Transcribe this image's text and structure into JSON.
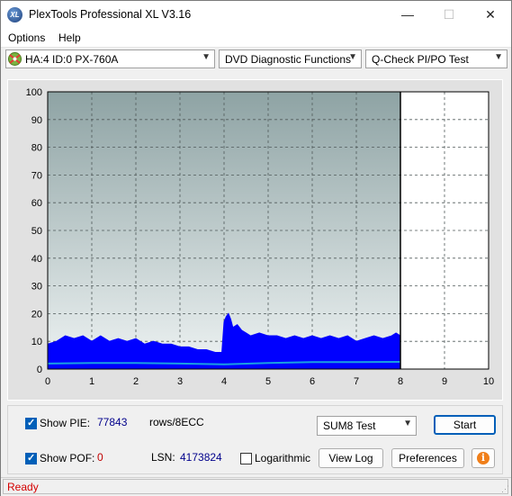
{
  "window": {
    "title": "PlexTools Professional XL V3.16",
    "icon_text": "XL",
    "controls": {
      "minimize": "—",
      "maximize": "☐",
      "close": "✕"
    }
  },
  "menu": {
    "options_label": "Options",
    "options_key": "O",
    "help_label": "Help",
    "help_key": "H"
  },
  "toolbar": {
    "drive": "HA:4 ID:0  PX-760A",
    "function": "DVD Diagnostic Functions",
    "test": "Q-Check PI/PO Test"
  },
  "chart_data": {
    "type": "area",
    "x_ticks": [
      "0",
      "1",
      "2",
      "3",
      "4",
      "5",
      "6",
      "7",
      "8",
      "9",
      "10"
    ],
    "y_ticks": [
      "0",
      "10",
      "20",
      "30",
      "40",
      "50",
      "60",
      "70",
      "80",
      "90",
      "100"
    ],
    "xlim": [
      0,
      10
    ],
    "ylim": [
      0,
      100
    ],
    "grid": true,
    "scan_end_x": 8,
    "series": [
      {
        "color": "#0000ff",
        "x": [
          0,
          0.2,
          0.4,
          0.6,
          0.8,
          1.0,
          1.2,
          1.4,
          1.6,
          1.8,
          2.0,
          2.2,
          2.4,
          2.6,
          2.8,
          3.0,
          3.2,
          3.4,
          3.6,
          3.8,
          3.95,
          4.0,
          4.05,
          4.1,
          4.15,
          4.2,
          4.3,
          4.4,
          4.5,
          4.6,
          4.8,
          5.0,
          5.2,
          5.4,
          5.6,
          5.8,
          6.0,
          6.2,
          6.4,
          6.6,
          6.8,
          7.0,
          7.2,
          7.4,
          7.6,
          7.8,
          7.9,
          8.0
        ],
        "values": [
          9,
          10,
          12,
          11,
          12,
          10,
          12,
          10,
          11,
          10,
          11,
          9,
          10,
          9,
          9,
          8,
          8,
          7,
          7,
          6,
          6,
          17,
          19,
          20,
          18,
          15,
          16,
          14,
          13,
          12,
          13,
          12,
          12,
          11,
          12,
          11,
          12,
          11,
          12,
          11,
          12,
          10,
          11,
          12,
          11,
          12,
          13,
          12
        ]
      },
      {
        "color": "#1aa0e0",
        "x": [
          0,
          1,
          2,
          3,
          4,
          5,
          6,
          7,
          8
        ],
        "values": [
          2.0,
          2.2,
          2.2,
          2.0,
          1.7,
          2.2,
          2.5,
          2.5,
          2.6
        ]
      }
    ]
  },
  "controls": {
    "show_pie_label": "Show PIE:",
    "pie_value": "77843",
    "pie_unit": "rows/8ECC",
    "show_pof_label": "Show POF:",
    "pof_value": "0",
    "lsn_label": "LSN:",
    "lsn_value": "4173824",
    "logarithmic_label": "Logarithmic",
    "test_select": "SUM8 Test",
    "start_button": "Start",
    "view_log_button": "View Log",
    "preferences_button": "Preferences",
    "info_icon": "i",
    "colors": {
      "pie_value": "#00008b",
      "pof_value": "#c00000",
      "lsn_value": "#00008b"
    }
  },
  "status": {
    "text": "Ready",
    "color": "#d40000"
  }
}
